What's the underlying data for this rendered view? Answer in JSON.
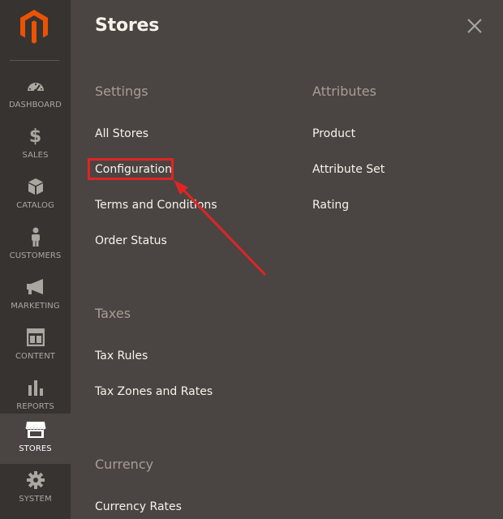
{
  "colors": {
    "sidebar_bg": "#373330",
    "panel_bg": "#4a4542",
    "brand_orange": "#eb5202",
    "highlight_red": "#e02424"
  },
  "sidebar": {
    "logo_icon": "magento-logo-icon",
    "items": [
      {
        "label": "DASHBOARD",
        "icon": "gauge-icon"
      },
      {
        "label": "SALES",
        "icon": "dollar-icon"
      },
      {
        "label": "CATALOG",
        "icon": "box-icon"
      },
      {
        "label": "CUSTOMERS",
        "icon": "person-icon"
      },
      {
        "label": "MARKETING",
        "icon": "megaphone-icon"
      },
      {
        "label": "CONTENT",
        "icon": "layout-icon"
      },
      {
        "label": "REPORTS",
        "icon": "bar-chart-icon"
      },
      {
        "label": "STORES",
        "icon": "store-icon",
        "active": true
      },
      {
        "label": "SYSTEM",
        "icon": "gear-icon"
      }
    ]
  },
  "panel": {
    "title": "Stores",
    "close_icon": "close-icon",
    "settings": {
      "title": "Settings",
      "links": [
        "All Stores",
        "Configuration",
        "Terms and Conditions",
        "Order Status"
      ]
    },
    "attributes": {
      "title": "Attributes",
      "links": [
        "Product",
        "Attribute Set",
        "Rating"
      ]
    },
    "taxes": {
      "title": "Taxes",
      "links": [
        "Tax Rules",
        "Tax Zones and Rates"
      ]
    },
    "currency": {
      "title": "Currency",
      "links": [
        "Currency Rates"
      ]
    }
  }
}
